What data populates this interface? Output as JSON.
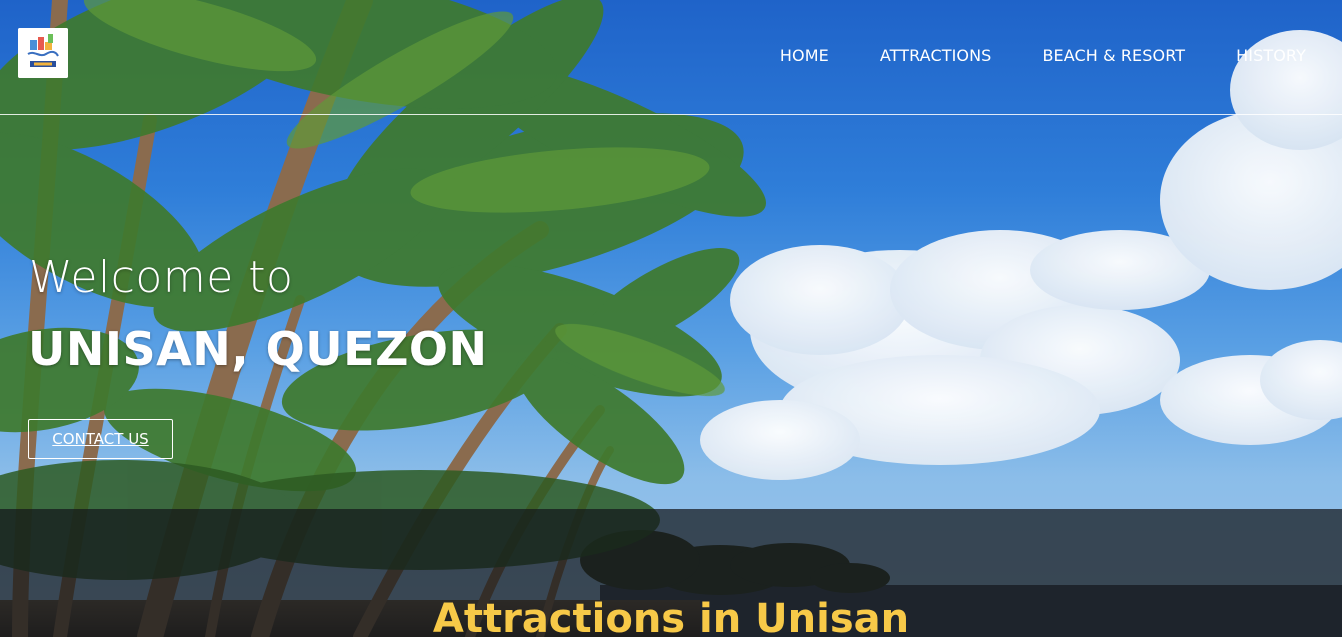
{
  "header": {
    "logo_icon": "unisan-tourism-logo",
    "nav": [
      {
        "label": "HOME"
      },
      {
        "label": "ATTRACTIONS"
      },
      {
        "label": "BEACH & RESORT"
      },
      {
        "label": "HISTORY"
      }
    ]
  },
  "hero": {
    "welcome": "Welcome to",
    "place": "UNISAN, QUEZON",
    "contact_button": "CONTACT US"
  },
  "section": {
    "title": "Attractions in Unisan"
  },
  "colors": {
    "accent": "#f7c948",
    "sky": "#2f7ed9",
    "nav_text": "#ffffff"
  }
}
